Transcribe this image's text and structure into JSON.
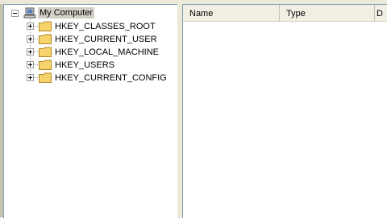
{
  "tree": {
    "root": {
      "label": "My Computer",
      "icon": "computer-icon",
      "expanded": true
    },
    "keys": [
      {
        "label": "HKEY_CLASSES_ROOT",
        "icon": "folder-icon"
      },
      {
        "label": "HKEY_CURRENT_USER",
        "icon": "folder-icon"
      },
      {
        "label": "HKEY_LOCAL_MACHINE",
        "icon": "folder-icon"
      },
      {
        "label": "HKEY_USERS",
        "icon": "folder-icon"
      },
      {
        "label": "HKEY_CURRENT_CONFIG",
        "icon": "folder-icon"
      }
    ]
  },
  "list": {
    "columns": [
      {
        "label": "Name"
      },
      {
        "label": "Type"
      },
      {
        "label": "D"
      }
    ]
  },
  "colors": {
    "selection": "#d4d0c8",
    "folder": "#f7d36b",
    "pane_border": "#7f9db9"
  }
}
